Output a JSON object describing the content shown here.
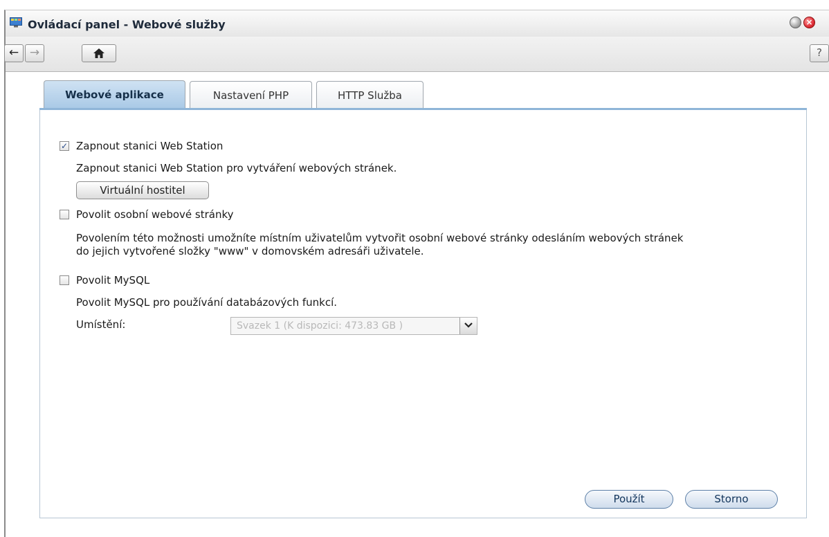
{
  "window": {
    "title": "Ovládací panel - Webové služby",
    "icons": [
      "control-panel-icon",
      "minimize-icon",
      "close-icon"
    ]
  },
  "toolbar": {
    "back_label": "←",
    "forward_label": "→",
    "home_label": "⌂",
    "help_label": "?"
  },
  "tabs": [
    {
      "label": "Webové aplikace",
      "active": true
    },
    {
      "label": "Nastavení PHP",
      "active": false
    },
    {
      "label": "HTTP Služba",
      "active": false
    }
  ],
  "web_station": {
    "checked": true,
    "label": "Zapnout stanici Web Station",
    "description": "Zapnout stanici Web Station pro vytváření webových stránek.",
    "vhost_button": "Virtuální hostitel"
  },
  "personal_pages": {
    "checked": false,
    "label": "Povolit osobní webové stránky",
    "description_line1": "Povolením této možnosti umožníte místním uživatelům vytvořit osobní webové stránky odesláním webových stránek",
    "description_line2": "do jejich vytvořené složky \"www\" v domovském adresáři uživatele."
  },
  "mysql": {
    "checked": false,
    "label": "Povolit MySQL",
    "description": "Povolit MySQL pro používání databázových funkcí.",
    "location_label": "Umístění:",
    "location_value": "Svazek 1 (K dispozici: 473.83 GB )"
  },
  "footer": {
    "apply_label": "Použít",
    "cancel_label": "Storno"
  },
  "colors": {
    "accent": "#a9c9e6",
    "tab_underline": "#8fb5d8"
  }
}
